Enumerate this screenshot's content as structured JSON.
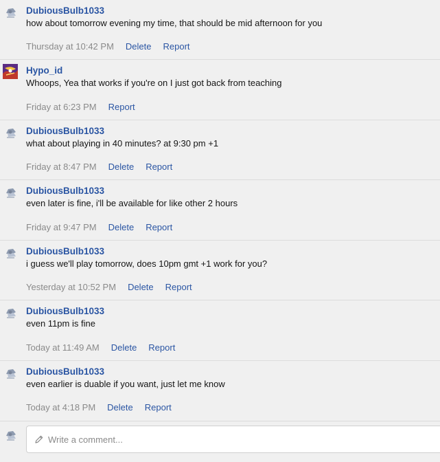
{
  "comments": [
    {
      "author": "DubiousBulb1033",
      "avatar": "default-avatar-icon",
      "text": "how about tomorrow evening my time, that should be mid afternoon for you",
      "time": "Thursday at 10:42 PM",
      "actions": [
        "Delete",
        "Report"
      ]
    },
    {
      "author": "Hypo_id",
      "avatar": "custom-avatar-image",
      "text": "Whoops, Yea that works if you're on I just got back from teaching",
      "time": "Friday at 6:23 PM",
      "actions": [
        "Report"
      ]
    },
    {
      "author": "DubiousBulb1033",
      "avatar": "default-avatar-icon",
      "text": "what about playing in 40 minutes? at 9:30 pm +1",
      "time": "Friday at 8:47 PM",
      "actions": [
        "Delete",
        "Report"
      ]
    },
    {
      "author": "DubiousBulb1033",
      "avatar": "default-avatar-icon",
      "text": "even later is fine, i'll be available for like other 2 hours",
      "time": "Friday at 9:47 PM",
      "actions": [
        "Delete",
        "Report"
      ]
    },
    {
      "author": "DubiousBulb1033",
      "avatar": "default-avatar-icon",
      "text": "i guess we'll play tomorrow, does 10pm gmt +1 work for you?",
      "time": "Yesterday at 10:52 PM",
      "actions": [
        "Delete",
        "Report"
      ]
    },
    {
      "author": "DubiousBulb1033",
      "avatar": "default-avatar-icon",
      "text": "even 11pm is fine",
      "time": "Today at 11:49 AM",
      "actions": [
        "Delete",
        "Report"
      ]
    },
    {
      "author": "DubiousBulb1033",
      "avatar": "default-avatar-icon",
      "text": "even earlier is duable if you want, just let me know",
      "time": "Today at 4:18 PM",
      "actions": [
        "Delete",
        "Report"
      ]
    }
  ],
  "composer": {
    "avatar": "default-avatar-icon",
    "placeholder": "Write a comment...",
    "icon": "pencil-icon"
  },
  "colors": {
    "link": "#2a55a3",
    "muted": "#8a8a8a",
    "text": "#141414",
    "background": "#f0f0f0",
    "divider": "#dcdcdc"
  }
}
